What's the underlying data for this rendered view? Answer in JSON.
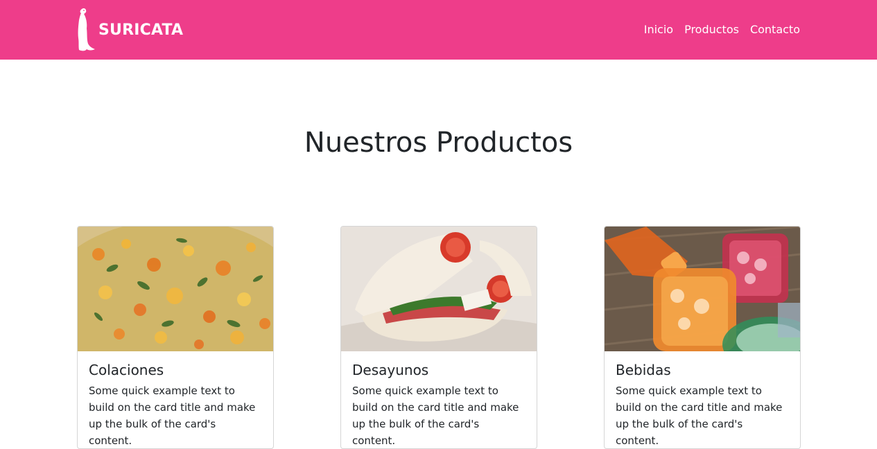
{
  "brand": {
    "name": "SURICATA"
  },
  "nav": {
    "items": [
      {
        "label": "Inicio"
      },
      {
        "label": "Productos"
      },
      {
        "label": "Contacto"
      }
    ]
  },
  "colors": {
    "navbar": "#ee3d8a",
    "text": "#212529"
  },
  "main": {
    "title": "Nuestros Productos",
    "cards": [
      {
        "image": "food-lentil-stew",
        "title": "Colaciones",
        "text": "Some quick example text to build on the card title and make up the bulk of the card's content."
      },
      {
        "image": "sandwich-pita",
        "title": "Desayunos",
        "text": "Some quick example text to build on the card title and make up the bulk of the card's content."
      },
      {
        "image": "drinks-glasses",
        "title": "Bebidas",
        "text": "Some quick example text to build on the card title and make up the bulk of the card's content."
      }
    ]
  }
}
